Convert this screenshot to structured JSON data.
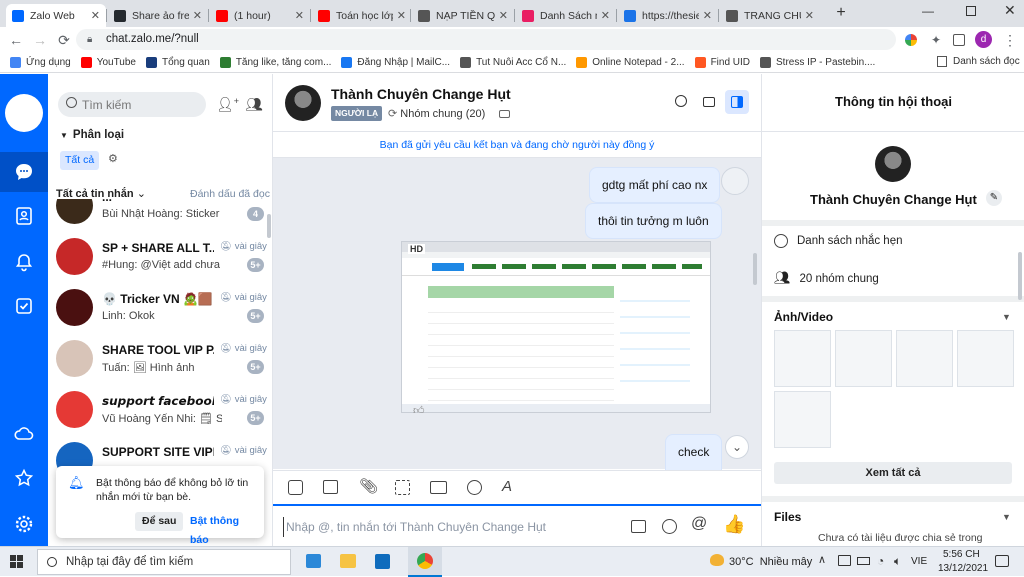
{
  "browser": {
    "tabs": [
      {
        "title": "Zalo Web",
        "icon": "zalo-icon",
        "color": "#0068ff"
      },
      {
        "title": "Share ảo free",
        "icon": "github-icon",
        "color": "#24292e"
      },
      {
        "title": "(1 hour)",
        "icon": "youtube-icon",
        "color": "#ff0000"
      },
      {
        "title": "Toán học lớp",
        "icon": "youtube-icon",
        "color": "#ff0000"
      },
      {
        "title": "NẠP TIỀN QU",
        "icon": "gear-icon",
        "color": "#555555"
      },
      {
        "title": "Danh Sách nh",
        "icon": "lock-icon",
        "color": "#e91e63"
      },
      {
        "title": "https://thesie",
        "icon": "diamond-icon",
        "color": "#1a73e8"
      },
      {
        "title": "TRANG CHỦ",
        "icon": "globe-icon",
        "color": "#555555"
      }
    ],
    "url": "chat.zalo.me/?null",
    "bookmarks": [
      {
        "label": "Ứng dụng",
        "color": "#4285f4"
      },
      {
        "label": "YouTube",
        "color": "#ff0000"
      },
      {
        "label": "Tổng quan",
        "color": "#1a3d7c"
      },
      {
        "label": "Tăng like, tăng com...",
        "color": "#2e7d32"
      },
      {
        "label": "Đăng Nhập | MailC...",
        "color": "#1877f2"
      },
      {
        "label": "Tut Nuôi Acc Cổ N...",
        "color": "#555555"
      },
      {
        "label": "Online Notepad - 2...",
        "color": "#ff9800"
      },
      {
        "label": "Find UID",
        "color": "#ff5722"
      },
      {
        "label": "Stress IP - Pastebin....",
        "color": "#555555"
      }
    ],
    "bookmark_folder": "Danh sách đọc"
  },
  "sidebar": {
    "search_placeholder": "Tìm kiếm",
    "classify_label": "Phân loại",
    "all_tag": "Tất cả",
    "all_messages": "Tất cả tin nhắn",
    "mark_read": "Đánh dấu đã đọc",
    "conversations": [
      {
        "name": "...",
        "message": "Bùi Nhật Hoàng: Sticker",
        "time": "",
        "badge": "4",
        "avatar": "#3b2a1a"
      },
      {
        "name": "SP + SHARE ALL T...",
        "message": "#Hung: @Việt add chưa mà...",
        "time": "vài giây",
        "badge": "5+",
        "avatar": "#c62828"
      },
      {
        "name": "💀 Tricker VN 🧟🟫",
        "message": "Linh: Okok",
        "time": "vài giây",
        "badge": "5+",
        "avatar": "#4a1010"
      },
      {
        "name": "SHARE TOOL VIP P...",
        "message": "Tuấn: 🖼 Hình ảnh",
        "time": "vài giây",
        "badge": "5+",
        "avatar": "#d8c4b8"
      },
      {
        "name": "𝙨𝙪𝙥𝙥𝙤𝙧𝙩 𝙛𝙖𝙘𝙚𝙗𝙤𝙤𝙠...",
        "message": "Vũ Hoàng Yến Nhi: 🗒 Stick...",
        "time": "vài giây",
        "badge": "5+",
        "avatar": "#e53935"
      },
      {
        "name": "SUPPORT SITE VIPF...",
        "message": "",
        "time": "vài giây",
        "badge": "",
        "avatar": "#1565c0"
      }
    ],
    "notification": {
      "text": "Bật thông báo để không bỏ lỡ tin nhắn mới từ bạn bè.",
      "later": "Để sau",
      "enable": "Bật thông báo"
    }
  },
  "chat": {
    "name": "Thành Chuyên Change Hụt",
    "tag": "NGƯỜI LẠ",
    "groups": "Nhóm chung (20)",
    "banner": "Bạn đã gửi yêu cầu kết bạn và đang chờ người này đồng ý",
    "messages": [
      {
        "text": "gdtg mất phí cao nx"
      },
      {
        "text": "thôi tin tưởng m luôn"
      },
      {
        "text": "check"
      }
    ],
    "image_hd": "HD",
    "compose_placeholder": "Nhập @, tin nhắn tới Thành Chuyên Change Hụt"
  },
  "info": {
    "title": "Thông tin hội thoại",
    "name": "Thành Chuyên Change Hụt",
    "reminders": "Danh sách nhắc hẹn",
    "groups": "20 nhóm chung",
    "media_title": "Ảnh/Video",
    "see_all": "Xem tất cả",
    "files_title": "Files",
    "files_empty": "Chưa có tài liệu được chia sẻ trong"
  },
  "taskbar": {
    "search_placeholder": "Nhập tại đây để tìm kiếm",
    "weather": "30°C  Nhiều mây",
    "lang": "VIE",
    "time": "5:56 CH",
    "date": "13/12/2021"
  }
}
